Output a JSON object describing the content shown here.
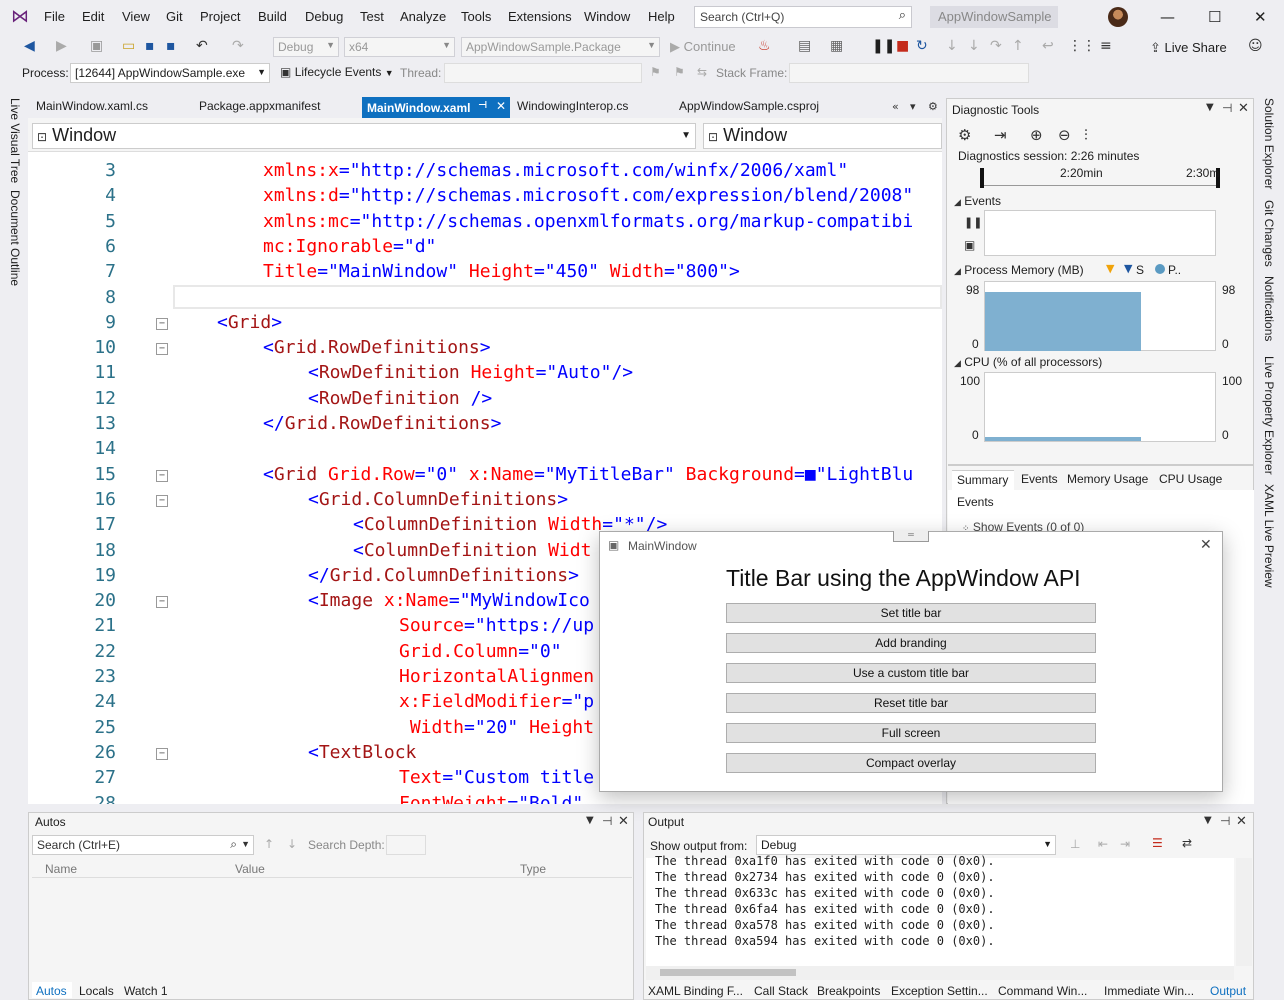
{
  "menu": [
    "File",
    "Edit",
    "View",
    "Git",
    "Project",
    "Build",
    "Debug",
    "Test",
    "Analyze",
    "Tools",
    "Extensions",
    "Window",
    "Help"
  ],
  "search": {
    "placeholder": "Search (Ctrl+Q)"
  },
  "app_name": "AppWindowSample",
  "toolbar": {
    "config": "Debug",
    "platform": "x64",
    "startup": "AppWindowSample.Package",
    "continue": "Continue",
    "live_share": "Live Share"
  },
  "debugbar": {
    "process_label": "Process:",
    "process_value": "[12644] AppWindowSample.exe",
    "lifecycle": "Lifecycle Events",
    "thread_label": "Thread:",
    "stack_label": "Stack Frame:"
  },
  "left_rail": [
    "Live Visual Tree",
    "Document Outline"
  ],
  "right_rail": [
    "Solution Explorer",
    "Git Changes",
    "Notifications",
    "Live Property Explorer",
    "XAML Live Preview"
  ],
  "tabs": [
    "MainWindow.xaml.cs",
    "Package.appxmanifest",
    "MainWindow.xaml",
    "WindowingInterop.cs",
    "AppWindowSample.csproj"
  ],
  "nav": {
    "left": "Window",
    "right": "Window"
  },
  "code_lines": [
    {
      "n": "3",
      "parts": [
        [
          "a",
          "xmlns:x"
        ],
        [
          "t",
          "=\"http://schemas.microsoft.com/winfx/2006/xaml\""
        ]
      ]
    },
    {
      "n": "4",
      "parts": [
        [
          "a",
          "xmlns:d"
        ],
        [
          "t",
          "=\"http://schemas.microsoft.com/expression/blend/2008\""
        ]
      ]
    },
    {
      "n": "5",
      "parts": [
        [
          "a",
          "xmlns:mc"
        ],
        [
          "t",
          "=\"http://schemas.openxmlformats.org/markup-compatibi"
        ]
      ]
    },
    {
      "n": "6",
      "parts": [
        [
          "a",
          "mc:Ignorable"
        ],
        [
          "t",
          "=\"d\""
        ]
      ]
    },
    {
      "n": "7",
      "parts": [
        [
          "a",
          "Title"
        ],
        [
          "t",
          "=\"MainWindow\" "
        ],
        [
          "a",
          "Height"
        ],
        [
          "t",
          "=\"450\" "
        ],
        [
          "a",
          "Width"
        ],
        [
          "t",
          "=\"800\">"
        ]
      ]
    },
    {
      "n": "8",
      "parts": []
    },
    {
      "n": "9",
      "parts": [
        [
          "t",
          "<"
        ],
        [
          "e",
          "Grid"
        ],
        [
          "t",
          ">"
        ]
      ]
    },
    {
      "n": "10",
      "parts": [
        [
          "t",
          "<"
        ],
        [
          "e",
          "Grid.RowDefinitions"
        ],
        [
          "t",
          ">"
        ]
      ]
    },
    {
      "n": "11",
      "parts": [
        [
          "t",
          "<"
        ],
        [
          "e",
          "RowDefinition "
        ],
        [
          "a",
          "Height"
        ],
        [
          "t",
          "=\"Auto\"/>"
        ]
      ]
    },
    {
      "n": "12",
      "parts": [
        [
          "t",
          "<"
        ],
        [
          "e",
          "RowDefinition "
        ],
        [
          "t",
          "/>"
        ]
      ]
    },
    {
      "n": "13",
      "parts": [
        [
          "t",
          "</"
        ],
        [
          "e",
          "Grid.RowDefinitions"
        ],
        [
          "t",
          ">"
        ]
      ]
    },
    {
      "n": "14",
      "parts": []
    },
    {
      "n": "15",
      "parts": [
        [
          "t",
          "<"
        ],
        [
          "e",
          "Grid "
        ],
        [
          "a",
          "Grid.Row"
        ],
        [
          "t",
          "=\"0\" "
        ],
        [
          "a",
          "x:Name"
        ],
        [
          "t",
          "=\"MyTitleBar\" "
        ],
        [
          "a",
          "Background"
        ],
        [
          "t",
          "=■\"LightBlu"
        ]
      ]
    },
    {
      "n": "16",
      "parts": [
        [
          "t",
          "<"
        ],
        [
          "e",
          "Grid.ColumnDefinitions"
        ],
        [
          "t",
          ">"
        ]
      ]
    },
    {
      "n": "17",
      "parts": [
        [
          "t",
          "<"
        ],
        [
          "e",
          "ColumnDefinition "
        ],
        [
          "a",
          "Width"
        ],
        [
          "t",
          "=\"*\"/>"
        ]
      ]
    },
    {
      "n": "18",
      "parts": [
        [
          "t",
          "<"
        ],
        [
          "e",
          "ColumnDefinition "
        ],
        [
          "a",
          "Widt"
        ]
      ]
    },
    {
      "n": "19",
      "parts": [
        [
          "t",
          "</"
        ],
        [
          "e",
          "Grid.ColumnDefinitions"
        ],
        [
          "t",
          ">"
        ]
      ]
    },
    {
      "n": "20",
      "parts": [
        [
          "t",
          "<"
        ],
        [
          "e",
          "Image "
        ],
        [
          "a",
          "x:Name"
        ],
        [
          "t",
          "=\"MyWindowIco"
        ]
      ]
    },
    {
      "n": "21",
      "parts": [
        [
          "a",
          "Source"
        ],
        [
          "t",
          "=\"https://up"
        ]
      ]
    },
    {
      "n": "22",
      "parts": [
        [
          "a",
          "Grid.Column"
        ],
        [
          "t",
          "=\"0\""
        ]
      ]
    },
    {
      "n": "23",
      "parts": [
        [
          "a",
          "HorizontalAlignmen"
        ]
      ]
    },
    {
      "n": "24",
      "parts": [
        [
          "a",
          "x:FieldModifier"
        ],
        [
          "t",
          "=\"p"
        ]
      ]
    },
    {
      "n": "25",
      "parts": [
        [
          "a",
          " Width"
        ],
        [
          "t",
          "=\"20\" "
        ],
        [
          "a",
          "Height"
        ]
      ]
    },
    {
      "n": "26",
      "parts": [
        [
          "t",
          "<"
        ],
        [
          "e",
          "TextBlock"
        ]
      ]
    },
    {
      "n": "27",
      "parts": [
        [
          "a",
          "Text"
        ],
        [
          "t",
          "=\"Custom title"
        ]
      ]
    },
    {
      "n": "28",
      "parts": [
        [
          "a",
          "FontWeight"
        ],
        [
          "t",
          "=\"Bold\""
        ]
      ]
    }
  ],
  "diag": {
    "title": "Diagnostic Tools",
    "session": "Diagnostics session: 2:26 minutes",
    "t1": "2:20min",
    "t2": "2:30m",
    "events": "Events",
    "memory": "Process Memory (MB)",
    "mem_max": "98",
    "mem_min": "0",
    "mem_leg_s": "S",
    "mem_leg_p": "P..",
    "cpu": "CPU (% of all processors)",
    "cpu_max": "100",
    "cpu_min": "0",
    "tabs": [
      "Summary",
      "Events",
      "Memory Usage",
      "CPU Usage"
    ],
    "events_header": "Events",
    "show_events": "Show Events (0 of 0)"
  },
  "appwin": {
    "title": "MainWindow",
    "heading": "Title Bar using the AppWindow API",
    "buttons": [
      "Set title bar",
      "Add branding",
      "Use a custom title bar",
      "Reset title bar",
      "Full screen",
      "Compact overlay"
    ]
  },
  "autos": {
    "title": "Autos",
    "search": "Search (Ctrl+E)",
    "depth": "Search Depth:",
    "cols": [
      "Name",
      "Value",
      "Type"
    ],
    "tabs": [
      "Autos",
      "Locals",
      "Watch 1"
    ]
  },
  "output": {
    "title": "Output",
    "from": "Show output from:",
    "source": "Debug",
    "lines": [
      "The thread 0xa1f0 has exited with code 0 (0x0).",
      "The thread 0x2734 has exited with code 0 (0x0).",
      "The thread 0x633c has exited with code 0 (0x0).",
      "The thread 0x6fa4 has exited with code 0 (0x0).",
      "The thread 0xa578 has exited with code 0 (0x0).",
      "The thread 0xa594 has exited with code 0 (0x0)."
    ],
    "tabs": [
      "XAML Binding F...",
      "Call Stack",
      "Breakpoints",
      "Exception Settin...",
      "Command Win...",
      "Immediate Win...",
      "Output"
    ]
  }
}
